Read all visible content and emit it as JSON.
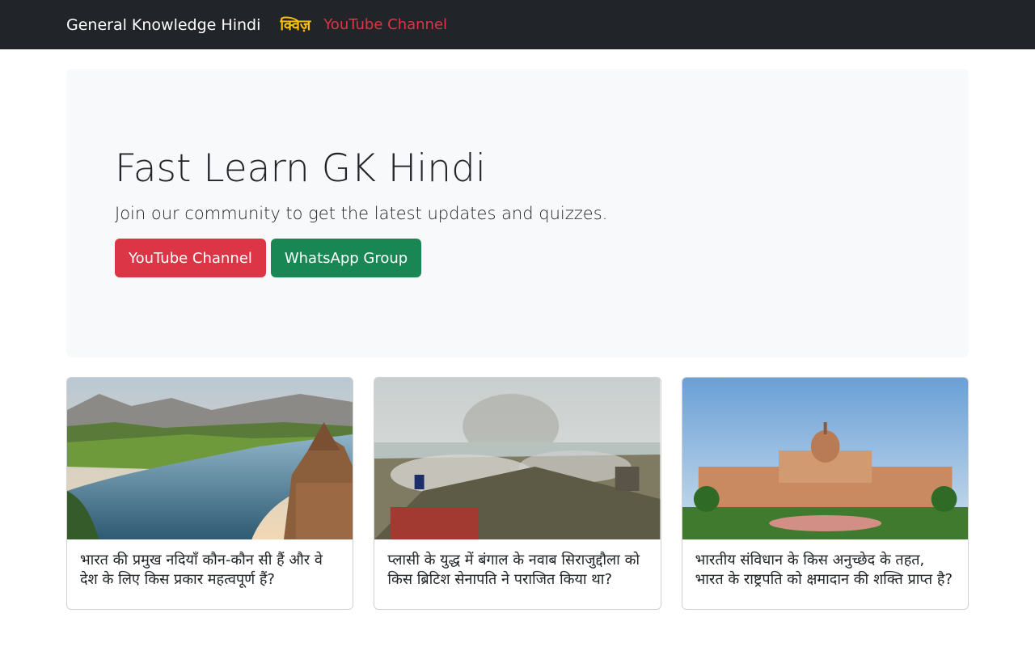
{
  "navbar": {
    "brand": "General Knowledge Hindi",
    "links": [
      {
        "label": "क्विज़"
      },
      {
        "label": "YouTube Channel"
      }
    ]
  },
  "hero": {
    "title": "Fast Learn GK Hindi",
    "subtitle": "Join our community to get the latest updates and quizzes.",
    "youtube_button": "YouTube Channel",
    "whatsapp_button": "WhatsApp Group"
  },
  "cards": [
    {
      "title": "भारत की प्रमुख नदियाँ कौन-कौन सी हैं और वे देश के लिए किस प्रकार महत्वपूर्ण हैं?",
      "image": "river-temple-landscape"
    },
    {
      "title": "प्लासी के युद्ध में बंगाल के नवाब सिराजुद्दौला को किस ब्रिटिश सेनापति ने पराजित किया था?",
      "image": "battle-of-plassey-scene"
    },
    {
      "title": "भारतीय संविधान के किस अनुच्छेद के तहत, भारत के राष्ट्रपति को क्षमादान की शक्ति प्राप्त है?",
      "image": "rashtrapati-bhavan"
    }
  ],
  "colors": {
    "navbar_bg": "#212529",
    "quiz_link": "#ffc107",
    "youtube_red": "#dc3545",
    "whatsapp_green": "#198754",
    "hero_bg": "#f8f9fa"
  }
}
